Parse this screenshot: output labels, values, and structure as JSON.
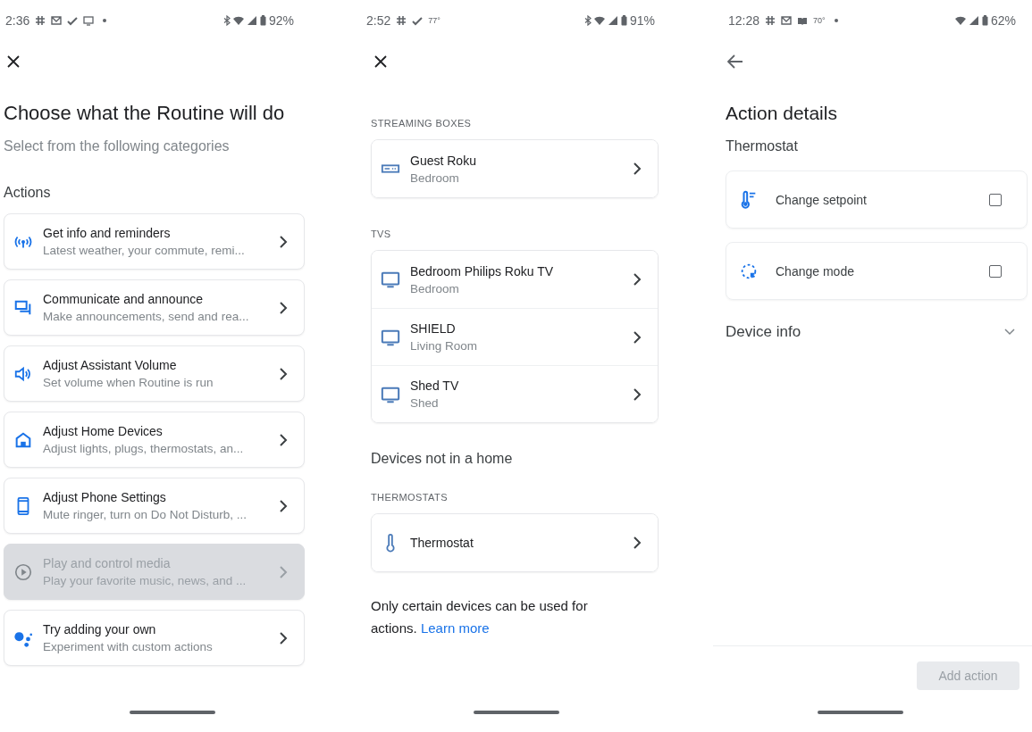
{
  "screens": [
    {
      "kind": "categories",
      "status_bar": {
        "time": "2:36",
        "battery": "92%"
      },
      "title": "Choose what the Routine will do",
      "subtitle": "Select from the following categories",
      "section": "Actions",
      "categories": [
        {
          "title": "Get info and reminders",
          "subtitle": "Latest weather, your commute, remi...",
          "disabled": false
        },
        {
          "title": "Communicate and announce",
          "subtitle": "Make announcements, send and rea...",
          "disabled": false
        },
        {
          "title": "Adjust Assistant Volume",
          "subtitle": "Set volume when Routine is run",
          "disabled": false
        },
        {
          "title": "Adjust Home Devices",
          "subtitle": "Adjust lights, plugs, thermostats, an...",
          "disabled": false
        },
        {
          "title": "Adjust Phone Settings",
          "subtitle": "Mute ringer, turn on Do Not Disturb, ...",
          "disabled": false
        },
        {
          "title": "Play and control media",
          "subtitle": "Play your favorite music, news, and ...",
          "disabled": true
        },
        {
          "title": "Try adding your own",
          "subtitle": "Experiment with custom actions",
          "disabled": false
        }
      ]
    },
    {
      "kind": "devices",
      "status_bar": {
        "time": "2:52",
        "temperature": "77°",
        "battery": "91%"
      },
      "groups": [
        {
          "heading": "STREAMING BOXES",
          "kind": "streaming_box",
          "devices": [
            {
              "name": "Guest Roku",
              "room": "Bedroom"
            }
          ]
        },
        {
          "heading": "TVS",
          "kind": "tv",
          "devices": [
            {
              "name": "Bedroom Philips Roku TV",
              "room": "Bedroom"
            },
            {
              "name": "SHIELD",
              "room": "Living Room"
            },
            {
              "name": "Shed TV",
              "room": "Shed"
            }
          ]
        }
      ],
      "other_heading": "Devices not in a home",
      "other_groups": [
        {
          "heading": "THERMOSTATS",
          "kind": "thermostat",
          "devices": [
            {
              "name": "Thermostat"
            }
          ]
        }
      ],
      "note": "Only certain devices can be used for actions.",
      "note_link": "Learn more"
    },
    {
      "kind": "action_details",
      "status_bar": {
        "time": "12:28",
        "temperature": "70°",
        "battery": "62%"
      },
      "title": "Action details",
      "subtitle": "Thermostat",
      "actions": [
        {
          "label": "Change setpoint",
          "checked": false
        },
        {
          "label": "Change mode",
          "checked": false
        }
      ],
      "device_info": {
        "label": "Device info",
        "expanded": false
      },
      "button": {
        "label": "Add action",
        "disabled": true
      }
    }
  ]
}
